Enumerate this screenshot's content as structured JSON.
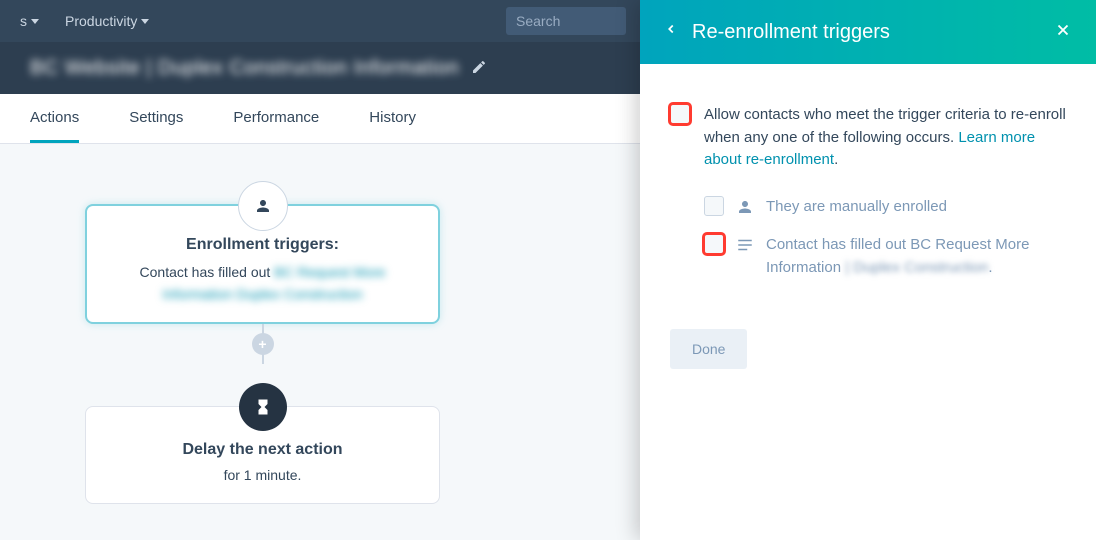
{
  "topbar": {
    "nav_s_label": "s",
    "productivity_label": "Productivity",
    "search_placeholder": "Search"
  },
  "titlebar": {
    "title_blurred": "BC Website | Duplex Construction Information"
  },
  "tabs": {
    "actions": "Actions",
    "settings": "Settings",
    "performance": "Performance",
    "history": "History"
  },
  "flow": {
    "enrollment_heading": "Enrollment triggers:",
    "enrollment_prefix": "Contact has filled out ",
    "enrollment_link_blurred": "BC Request More",
    "enrollment_link2_blurred": "Information Duplex Construction",
    "delay_heading": "Delay the next action",
    "delay_sub": "for 1 minute."
  },
  "panel": {
    "title": "Re-enrollment triggers",
    "main_text": "Allow contacts who meet the trigger criteria to re-enroll when any one of the following occurs. ",
    "learn_link": "Learn more about re-enrollment",
    "opt_manual": "They are manually enrolled",
    "opt_form_prefix": "Contact has filled out ",
    "opt_form_link": "BC Request More Information ",
    "opt_form_blurred": "| Duplex Construction",
    "done": "Done"
  }
}
